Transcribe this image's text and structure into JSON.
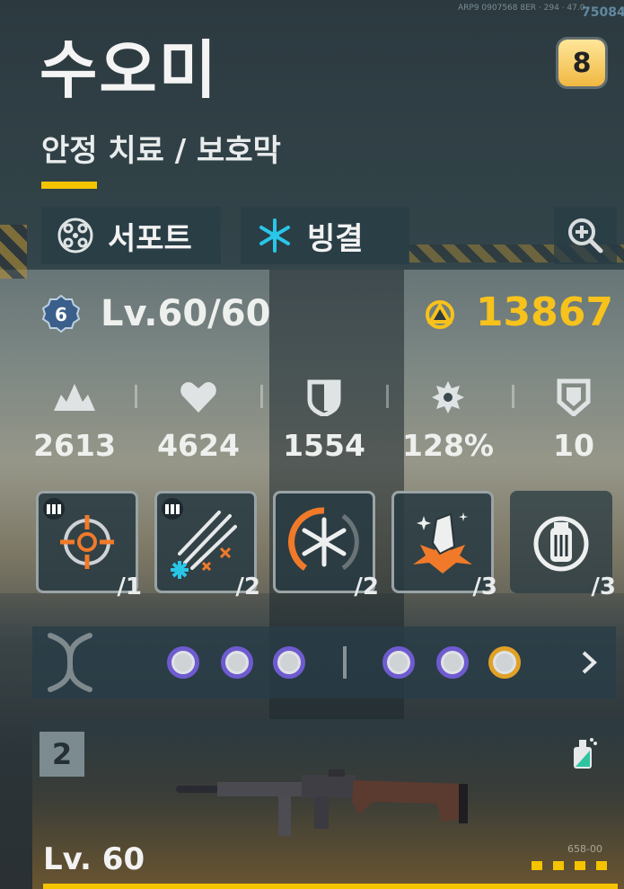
{
  "character": {
    "name": "수오미",
    "role": "안정 치료 / 보호막",
    "rank": "8",
    "class_tag": {
      "label": "서포트",
      "icon": "support-crosshair-icon"
    },
    "element_tag": {
      "label": "빙결",
      "icon": "snowflake-icon"
    },
    "level_badge": "6",
    "level": "Lv.60/60",
    "combat_power": "13867"
  },
  "hud": {
    "code": "ARP9 0907568 8ER · 294 · 47.0",
    "counter": "75084"
  },
  "stats": [
    {
      "icon": "attack-icon",
      "value": "2613"
    },
    {
      "icon": "health-icon",
      "value": "4624"
    },
    {
      "icon": "defense-icon",
      "value": "1554"
    },
    {
      "icon": "crit-icon",
      "value": "128%"
    },
    {
      "icon": "armor-icon",
      "value": "10"
    }
  ],
  "skills": [
    {
      "name": "skill-basic-shot",
      "count": "/1"
    },
    {
      "name": "skill-ice-barrage",
      "count": "/2"
    },
    {
      "name": "skill-freeze-aura",
      "count": "/2"
    },
    {
      "name": "skill-crystal-burst",
      "count": "/3"
    },
    {
      "name": "skill-ice-canister",
      "count": "/3"
    }
  ],
  "weapon": {
    "slot": "2",
    "level": "Lv. 60",
    "code": "658-00"
  },
  "colors": {
    "accent": "#f5c400",
    "combat_power": "#f7c21c",
    "ice": "#29c6e8",
    "orange": "#f07a2a",
    "purple_mod": "#6f5bd0",
    "gold_mod": "#e0a126"
  }
}
